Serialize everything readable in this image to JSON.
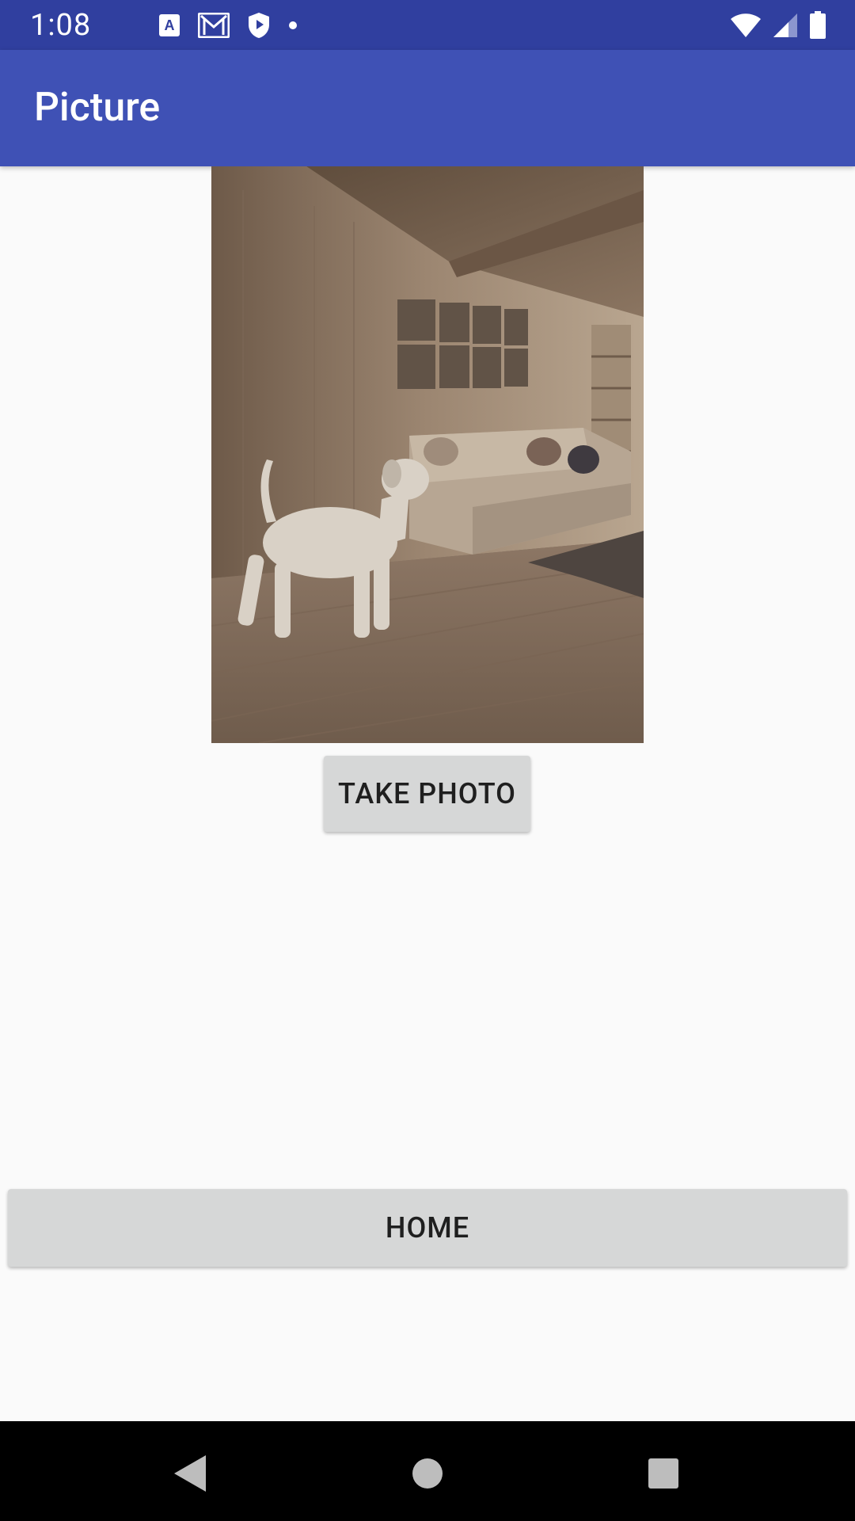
{
  "status_bar": {
    "time": "1:08",
    "left_icons": [
      "a-translate-icon",
      "gmail-icon",
      "shield-play-icon",
      "dot-icon"
    ],
    "right_icons": [
      "wifi-icon",
      "signal-icon",
      "battery-icon"
    ],
    "background_color": "#303f9f"
  },
  "app_bar": {
    "title": "Picture",
    "background_color": "#3f51b5"
  },
  "photo": {
    "description_icon": "dog-in-living-room-image"
  },
  "buttons": {
    "take_photo_label": "TAKE PHOTO",
    "home_label": "HOME"
  },
  "nav_bar": {
    "icons": [
      "back-icon",
      "home-circle-icon",
      "recents-square-icon"
    ]
  }
}
